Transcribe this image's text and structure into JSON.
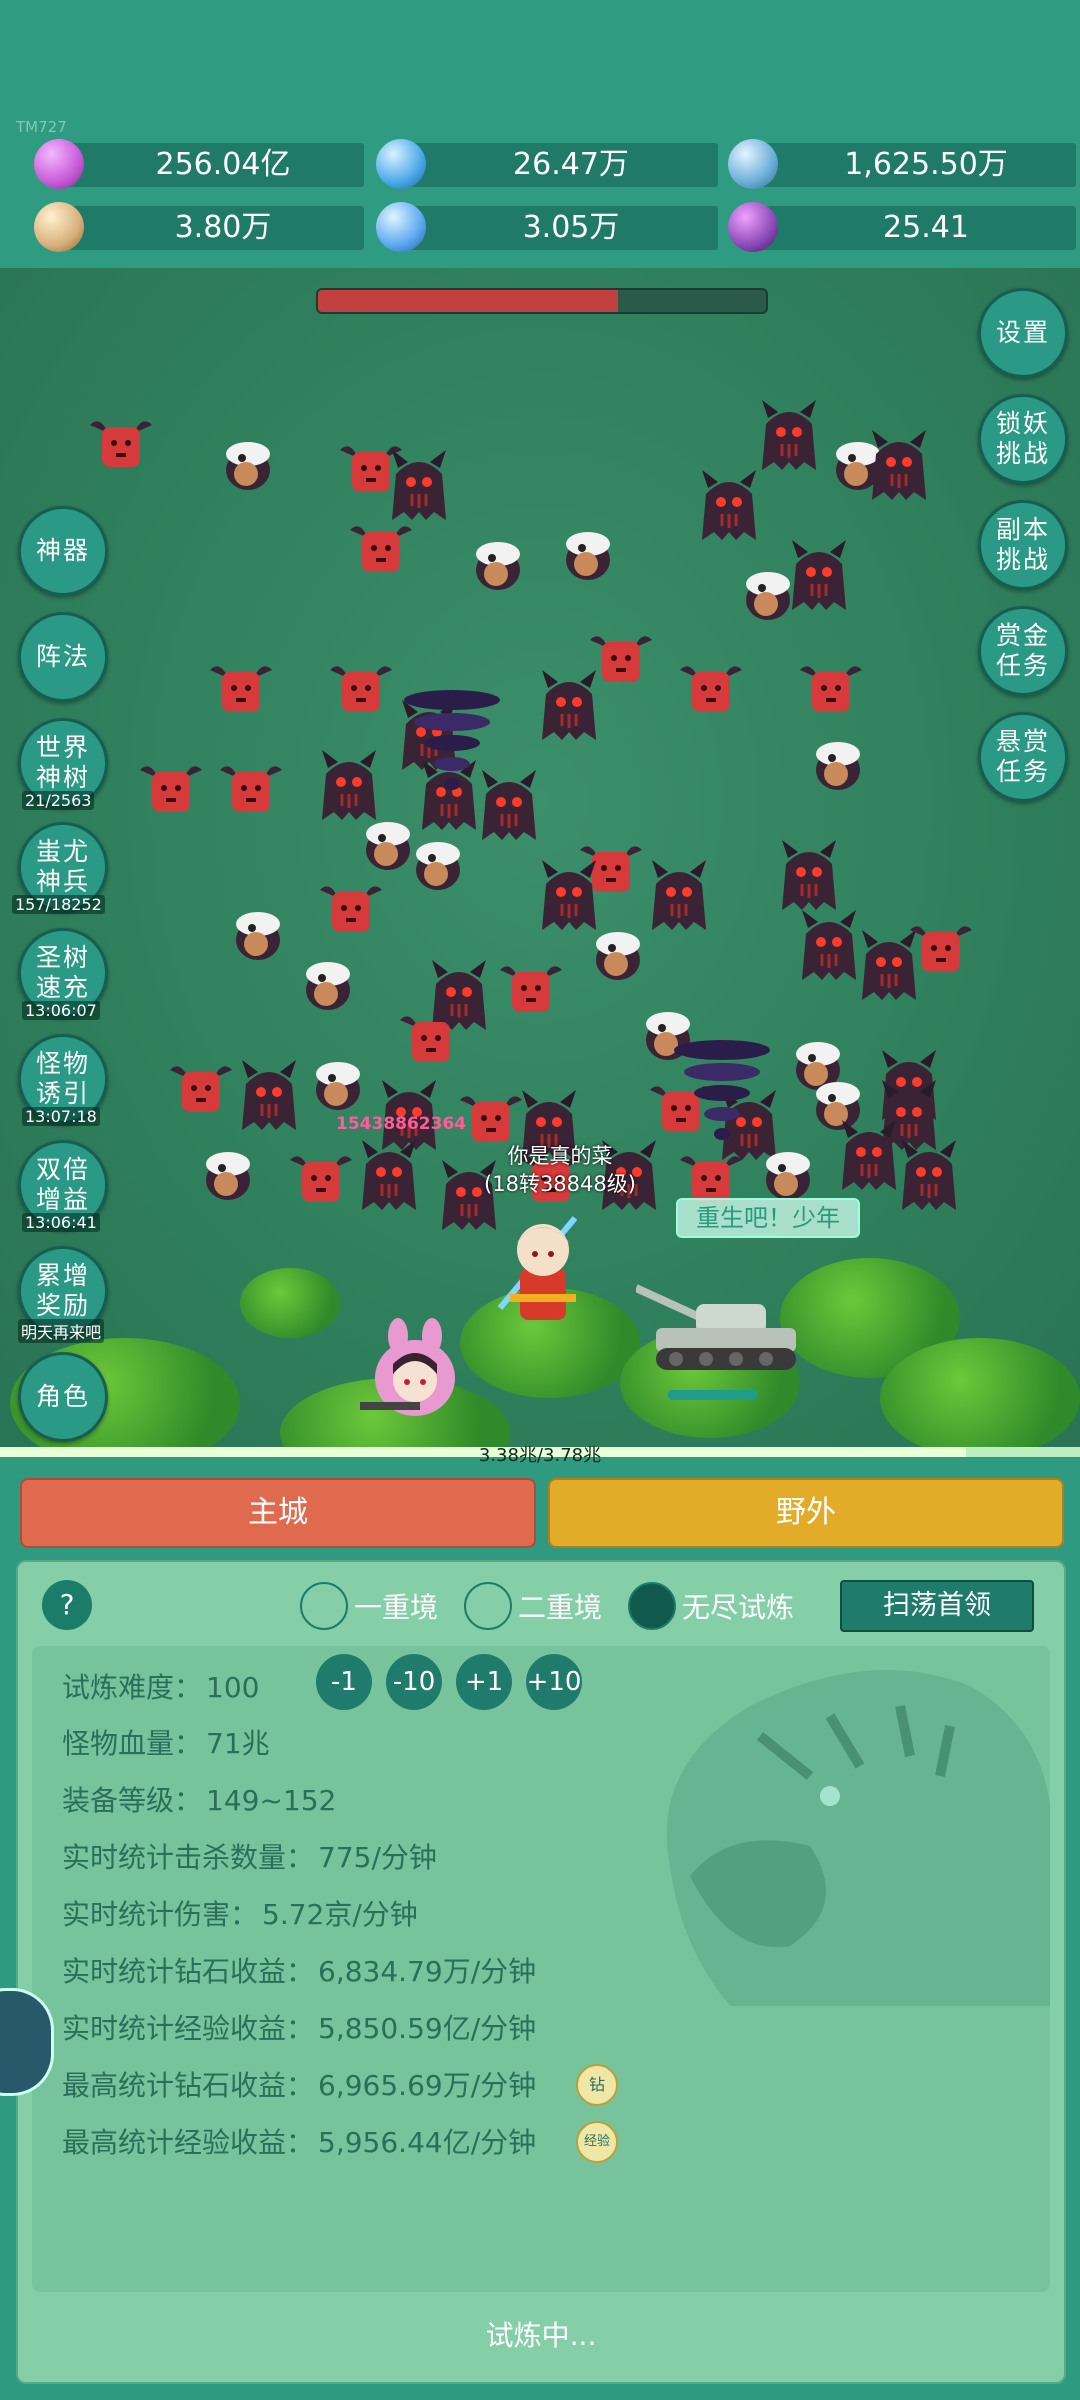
{
  "app": {
    "id_text": "TM727"
  },
  "resources": [
    {
      "icon": "diamond-icon",
      "value": "256.04亿",
      "color": "#c85ad8"
    },
    {
      "icon": "blue-gem-icon",
      "value": "26.47万",
      "color": "#4aa8e8"
    },
    {
      "icon": "experience-orb-icon",
      "value": "1,625.50万",
      "color": "#6aaed8"
    },
    {
      "icon": "scroll-icon",
      "value": "3.80万",
      "color": "#d8b07a"
    },
    {
      "icon": "crystal-icon",
      "value": "3.05万",
      "color": "#5aa8f0"
    },
    {
      "icon": "purple-pouch-icon",
      "value": "25.41",
      "color": "#8a4ab8"
    }
  ],
  "boss_hp_fraction": 0.67,
  "left_menu": {
    "artifact": "神器",
    "formation": "阵法",
    "world_tree": "世界\n神树",
    "world_tree_sub": "21/2563",
    "chiyou": "蚩尤\n神兵",
    "chiyou_sub": "157/18252",
    "holy_tree": "圣树\n速充",
    "holy_tree_sub": "13:06:07",
    "lure": "怪物\n诱引",
    "lure_sub": "13:07:18",
    "double": "双倍\n增益",
    "double_sub": "13:06:41",
    "cumulative": "累增\n奖励",
    "cumulative_sub": "明天再来吧",
    "character": "角色"
  },
  "right_menu": {
    "settings": "设置",
    "demon_lock": "锁妖\n挑战",
    "dungeon": "副本\n挑战",
    "gold_bounty": "赏金\n任务",
    "wanted": "悬赏\n任务"
  },
  "battle": {
    "damage_text": "15438862364",
    "player_name": "你是真的菜",
    "player_level": "(18转38848级)",
    "speech": "重生吧！少年",
    "progress_text": "3.38兆/3.78兆",
    "progress_fraction": 0.894
  },
  "tabs": {
    "city": "主城",
    "wild": "野外"
  },
  "panel": {
    "help": "?",
    "modes": [
      "一重境",
      "二重境",
      "无尽试炼"
    ],
    "selected_mode_index": 2,
    "sweep_label": "扫荡首领",
    "steps": [
      "-1",
      "-10",
      "+1",
      "+10"
    ],
    "stats": [
      {
        "label": "试炼难度：",
        "value": "100"
      },
      {
        "label": "怪物血量：",
        "value": "71兆"
      },
      {
        "label": "装备等级：",
        "value": "149~152"
      },
      {
        "label": "实时统计击杀数量：",
        "value": "775/分钟"
      },
      {
        "label": "实时统计伤害：",
        "value": "5.72京/分钟"
      },
      {
        "label": "实时统计钻石收益：",
        "value": "6,834.79万/分钟"
      },
      {
        "label": "实时统计经验收益：",
        "value": "5,850.59亿/分钟"
      },
      {
        "label": "最高统计钻石收益：",
        "value": "6,965.69万/分钟"
      },
      {
        "label": "最高统计经验收益：",
        "value": "5,956.44亿/分钟"
      }
    ],
    "diamond_badge": "钻",
    "exp_badge": "经验",
    "status": "试炼中..."
  }
}
